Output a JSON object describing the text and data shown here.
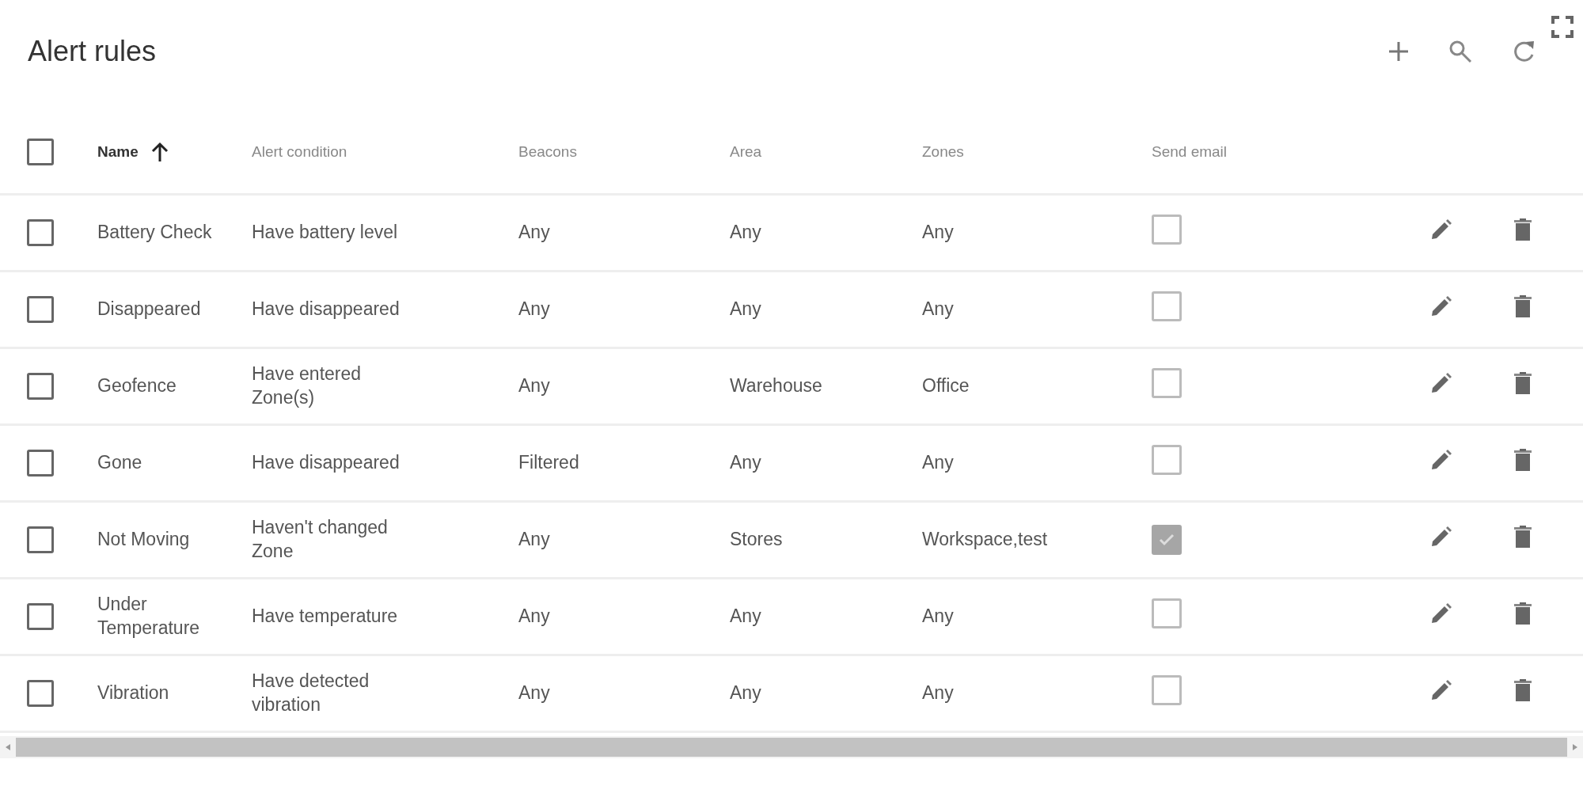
{
  "title": "Alert rules",
  "columns": [
    {
      "label": "Name",
      "sorted": true
    },
    {
      "label": "Alert condition",
      "sorted": false
    },
    {
      "label": "Beacons",
      "sorted": false
    },
    {
      "label": "Area",
      "sorted": false
    },
    {
      "label": "Zones",
      "sorted": false
    },
    {
      "label": "Send email",
      "sorted": false
    }
  ],
  "select_all": {
    "checked": false
  },
  "rows": [
    {
      "checked": false,
      "name": "Battery Check",
      "condition": "Have battery level",
      "beacons": "Any",
      "area": "Any",
      "zones": "Any",
      "send_email": false
    },
    {
      "checked": false,
      "name": "Disappeared",
      "condition": "Have disappeared",
      "beacons": "Any",
      "area": "Any",
      "zones": "Any",
      "send_email": false
    },
    {
      "checked": false,
      "name": "Geofence",
      "condition": "Have entered Zone(s)",
      "beacons": "Any",
      "area": "Warehouse",
      "zones": "Office",
      "send_email": false
    },
    {
      "checked": false,
      "name": "Gone",
      "condition": "Have disappeared",
      "beacons": "Filtered",
      "area": "Any",
      "zones": "Any",
      "send_email": false
    },
    {
      "checked": false,
      "name": "Not Moving",
      "condition": "Haven't changed Zone",
      "beacons": "Any",
      "area": "Stores",
      "zones": "Workspace,test",
      "send_email": true
    },
    {
      "checked": false,
      "name": "Under Temperature",
      "condition": "Have temperature",
      "beacons": "Any",
      "area": "Any",
      "zones": "Any",
      "send_email": false
    },
    {
      "checked": false,
      "name": "Vibration",
      "condition": "Have detected vibration",
      "beacons": "Any",
      "area": "Any",
      "zones": "Any",
      "send_email": false
    }
  ]
}
